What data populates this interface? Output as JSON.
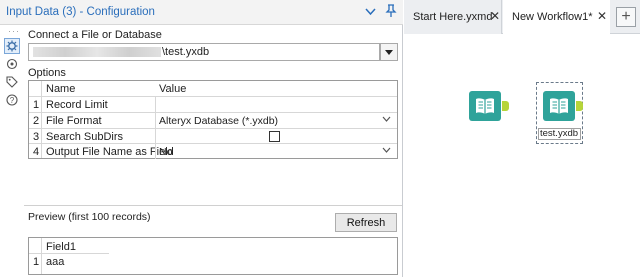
{
  "config_panel": {
    "title": "Input Data (3) - Configuration",
    "connect_label": "Connect a File or Database",
    "file_path": "\\test.yxdb",
    "options_label": "Options",
    "options_header": {
      "name": "Name",
      "value": "Value"
    },
    "options": [
      {
        "num": "1",
        "name": "Record Limit",
        "value": ""
      },
      {
        "num": "2",
        "name": "File Format",
        "value": "Alteryx Database (*.yxdb)"
      },
      {
        "num": "3",
        "name": "Search SubDirs",
        "value": ""
      },
      {
        "num": "4",
        "name": "Output File Name as Field",
        "value": "No"
      }
    ],
    "preview_label": "Preview (first 100 records)",
    "refresh_label": "Refresh",
    "preview": {
      "column": "Field1",
      "row_num": "1",
      "cell": "aaa"
    },
    "sidebar_icons": [
      "gear-icon",
      "target-icon",
      "tag-icon",
      "help-icon"
    ]
  },
  "tabs": [
    {
      "label": "Start Here.yxmd"
    },
    {
      "label": "New Workflow1*"
    }
  ],
  "canvas": {
    "tool_caption": "test.yxdb"
  },
  "colors": {
    "accent": "#2a6ebb",
    "tool": "#2fa39a",
    "anchor": "#b6d53a"
  }
}
